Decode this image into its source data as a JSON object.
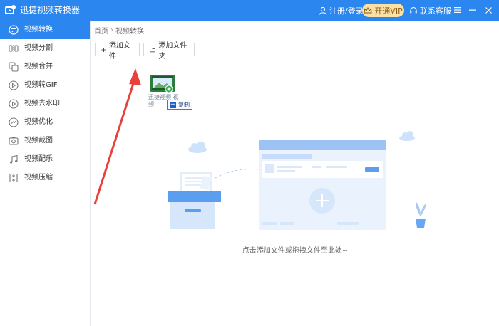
{
  "app": {
    "title": "迅捷视频转换器"
  },
  "header": {
    "login_label": "注册/登录",
    "vip_label": "开通VIP",
    "service_label": "联系客服",
    "icons": [
      "user-icon",
      "crown-icon",
      "headset-icon",
      "menu-icon",
      "minimize-icon",
      "close-icon"
    ]
  },
  "colors": {
    "primary": "#2b86f0",
    "vip_bg": "#fbe1a6",
    "vip_text": "#8a5a12",
    "arrow": "#e8403a"
  },
  "sidebar": {
    "items": [
      {
        "label": "视频转换",
        "icon": "convert-icon",
        "active": true
      },
      {
        "label": "视频分割",
        "icon": "split-icon",
        "active": false
      },
      {
        "label": "视频合并",
        "icon": "merge-icon",
        "active": false
      },
      {
        "label": "视频转GIF",
        "icon": "gif-icon",
        "active": false
      },
      {
        "label": "视频去水印",
        "icon": "watermark-icon",
        "active": false
      },
      {
        "label": "视频优化",
        "icon": "optimize-icon",
        "active": false
      },
      {
        "label": "视频截图",
        "icon": "screenshot-icon",
        "active": false
      },
      {
        "label": "视频配乐",
        "icon": "music-icon",
        "active": false
      },
      {
        "label": "视频压缩",
        "icon": "compress-icon",
        "active": false
      }
    ]
  },
  "breadcrumb": {
    "home": "首页",
    "separator": "›",
    "current": "视频转换"
  },
  "toolbar": {
    "add_file": "添加文件",
    "add_folder": "添加文件夹"
  },
  "drag": {
    "file_name": "迅捷视频 视频",
    "copy_label": "复制"
  },
  "dropzone": {
    "hint": "点击添加文件或拖拽文件至此处~"
  }
}
